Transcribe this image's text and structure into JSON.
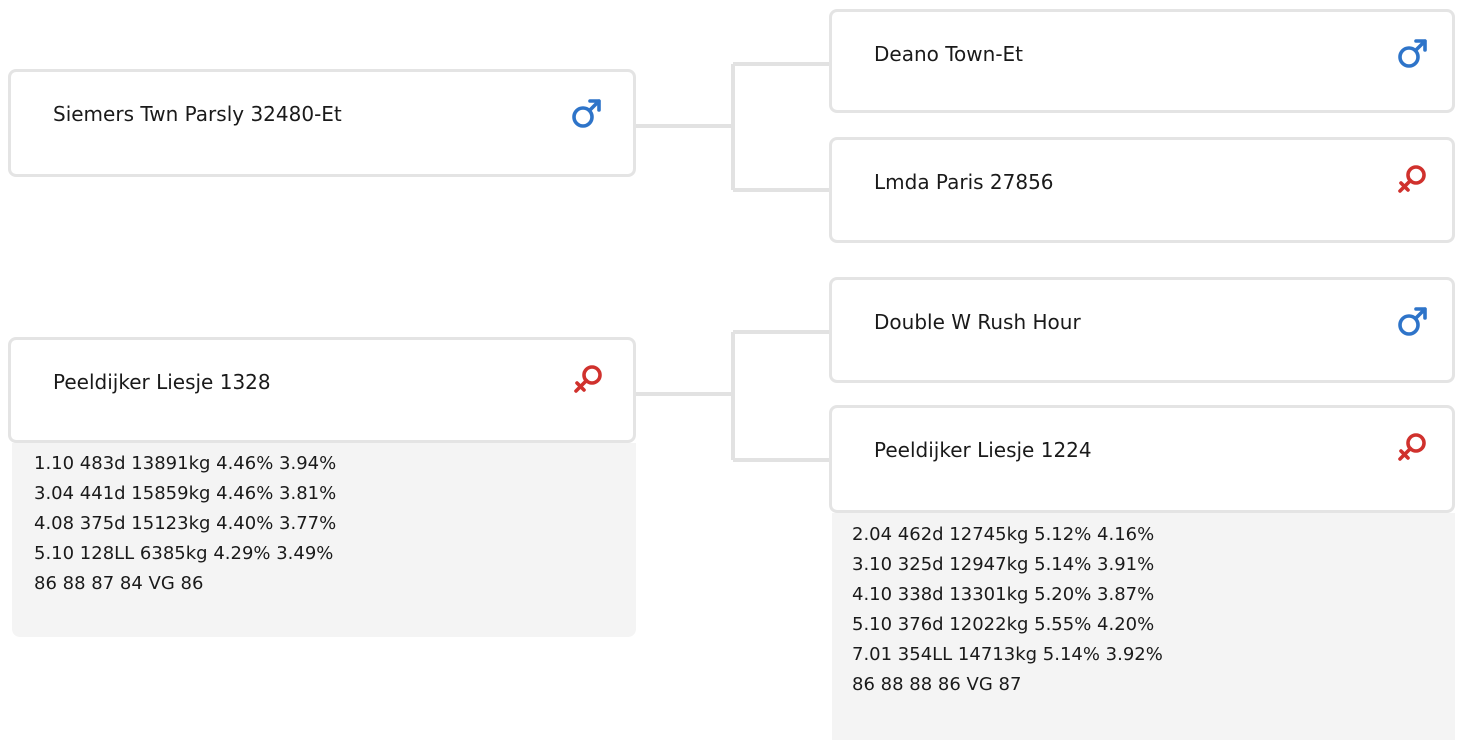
{
  "pedigree": {
    "parents": [
      {
        "name": "Siemers Twn Parsly 32480-Et",
        "sex": "male",
        "icon": "male-icon",
        "stats": []
      },
      {
        "name": "Peeldijker Liesje 1328",
        "sex": "female",
        "icon": "female-icon",
        "stats": [
          "1.10 483d 13891kg 4.46% 3.94%",
          "3.04 441d 15859kg 4.46% 3.81%",
          "4.08 375d 15123kg 4.40% 3.77%",
          "5.10 128LL 6385kg 4.29% 3.49%",
          "86 88 87 84 VG 86"
        ]
      }
    ],
    "grandparents": [
      {
        "name": "Deano Town-Et",
        "sex": "male",
        "icon": "male-icon",
        "stats": []
      },
      {
        "name": "Lmda Paris 27856",
        "sex": "female",
        "icon": "female-icon",
        "stats": []
      },
      {
        "name": "Double W Rush Hour",
        "sex": "male",
        "icon": "male-icon",
        "stats": []
      },
      {
        "name": "Peeldijker Liesje 1224",
        "sex": "female",
        "icon": "female-icon",
        "stats": [
          "2.04 462d 12745kg 5.12% 4.16%",
          "3.10 325d 12947kg 5.14% 3.91%",
          "4.10 338d 13301kg 5.20% 3.87%",
          "5.10 376d 12022kg 5.55% 4.20%",
          "7.01 354LL 14713kg 5.14% 3.92%",
          "86 88 88 86 VG 87"
        ]
      }
    ]
  },
  "colors": {
    "male": "#2e74c9",
    "female": "#d0312d",
    "card_border": "#e4e4e4",
    "stats_bg": "#f4f4f4",
    "connector": "#e2e2e2"
  }
}
